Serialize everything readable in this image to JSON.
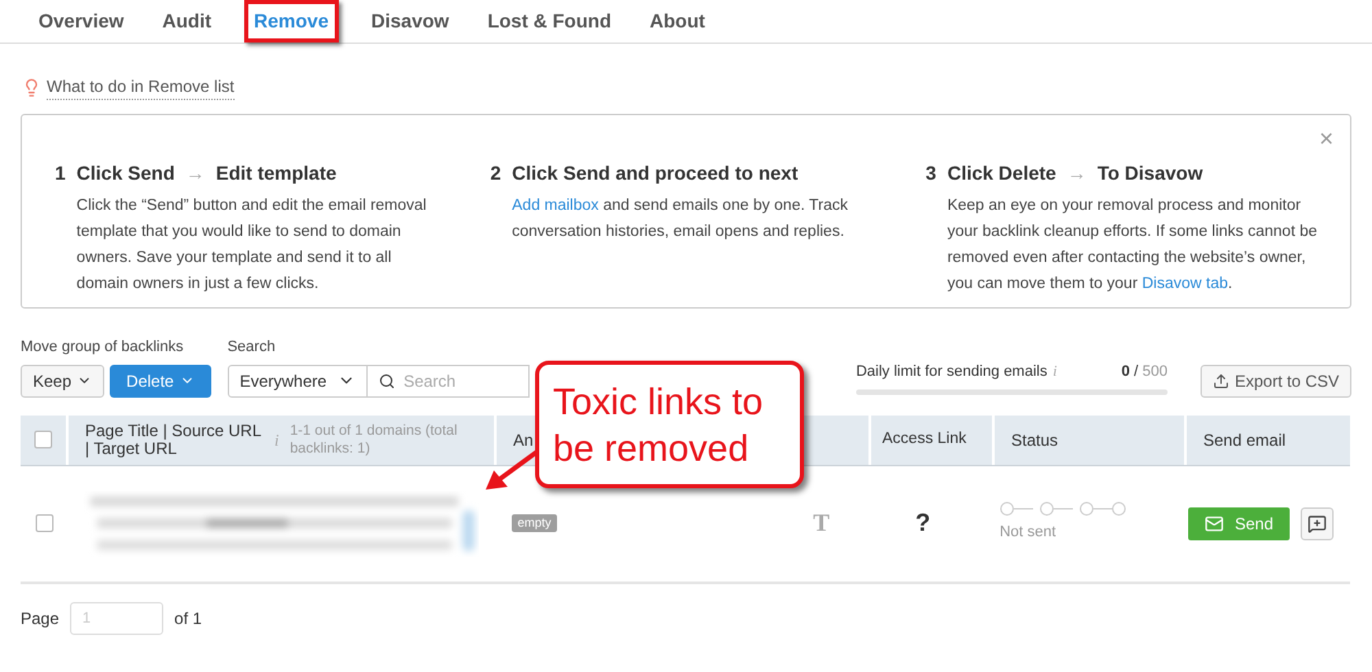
{
  "tabs": [
    {
      "label": "Overview",
      "selected": false,
      "highlighted": false
    },
    {
      "label": "Audit",
      "selected": false,
      "highlighted": false
    },
    {
      "label": "Remove",
      "selected": true,
      "highlighted": true
    },
    {
      "label": "Disavow",
      "selected": false,
      "highlighted": false
    },
    {
      "label": "Lost & Found",
      "selected": false,
      "highlighted": false
    },
    {
      "label": "About",
      "selected": false,
      "highlighted": false
    }
  ],
  "hint_link": "What to do in Remove list",
  "steps": [
    {
      "number": "1",
      "title": "Click Send",
      "arrow": "→",
      "title_2": "Edit template",
      "text": "Click the “Send” button and edit the email removal template that you would like to send to domain owners. Save your template and send it to all domain owners in just a few clicks."
    },
    {
      "number": "2",
      "title": "Click Send and proceed to next",
      "link": "Add mailbox",
      "text": " and send emails one by one. Track conversation histories, email opens and replies."
    },
    {
      "number": "3",
      "title": "Click Delete",
      "arrow": "→",
      "title_2": "To Disavow",
      "text": "Keep an eye on your removal process and monitor your backlink cleanup efforts. If some links cannot be removed even after contacting the website’s owner, you can move them to your ",
      "link_end": "Disavow tab",
      "text_after": "."
    }
  ],
  "close": "×",
  "toolbar": {
    "move_label": "Move group of backlinks",
    "search_label": "Search",
    "keep_button": "Keep",
    "delete_button": "Delete",
    "scope_select": "Everywhere",
    "search_placeholder": "Search",
    "limit_label": "Daily limit for sending emails",
    "limit_info": "i",
    "limit_used": "0",
    "limit_sep": " / ",
    "limit_total": "500",
    "limit": {
      "level": 0
    },
    "export_button": "Export to CSV"
  },
  "table": {
    "columns": [
      "Page Title | Source URL | Target URL",
      "An",
      "Access Link",
      "Status",
      "Send email"
    ],
    "info": "i",
    "count_note": "1-1 out of 1 domains (total backlinks: 1)",
    "rows": [
      {
        "checked": false,
        "anchor_tag": "empty",
        "anchor_type": "T",
        "access": "?",
        "status": "Not sent",
        "send": "Send"
      }
    ]
  },
  "header_checked": false,
  "pagination": {
    "label": "Page",
    "placeholder": "1",
    "of": "of 1"
  },
  "callout": {
    "text": "Toxic links to be removed"
  }
}
